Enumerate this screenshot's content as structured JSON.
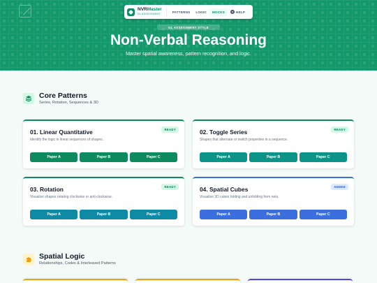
{
  "nav": {
    "brand_name_a": "NVR",
    "brand_name_b": "Master",
    "brand_tag": "GL ASSESSMENT",
    "items": [
      "PATTERNS",
      "LOGIC",
      "MOCKS",
      "HELP"
    ],
    "active": "MOCKS",
    "help_icon_glyph": "?"
  },
  "hero": {
    "pill": "GL ASSESSMENT STYLE",
    "title": "Non-Verbal Reasoning",
    "subtitle": "Master spatial awareness, pattern recognition, and logic."
  },
  "sections": [
    {
      "title": "Core Patterns",
      "desc": "Series, Rotation, Sequences & 3D",
      "icon": "layers-icon",
      "cards": [
        {
          "title": "01. Linear Quantitative",
          "desc": "Identify the logic in linear sequences of shapes.",
          "badge": "READY",
          "color": "#0e8a5f",
          "buttons": [
            "Paper A",
            "Paper B",
            "Paper C"
          ]
        },
        {
          "title": "02. Toggle Series",
          "desc": "Shapes that alternate or switch properties in a sequence.",
          "badge": "READY",
          "color": "#0d9488",
          "buttons": [
            "Paper A",
            "Paper B",
            "Paper C"
          ]
        },
        {
          "title": "03. Rotation",
          "desc": "Visualize shapes rotating clockwise or anti-clockwise.",
          "badge": "READY",
          "color": "#0e8aa5",
          "buttons": [
            "Paper A",
            "Paper B",
            "Paper C"
          ]
        },
        {
          "title": "04. Spatial Cubes",
          "desc": "Visualize 3D cubes folding and unfolding from nets.",
          "badge": "ADDED",
          "color": "#3b6fe0",
          "buttons": [
            "Paper A",
            "Paper B",
            "Paper C"
          ]
        }
      ]
    },
    {
      "title": "Spatial Logic",
      "desc": "Relationships, Codes & Interleaved Patterns",
      "icon": "puzzle-icon"
    }
  ],
  "colors": {
    "hero_bg": "#12996a",
    "partial_accents": [
      "#f59e0b",
      "#f59e0b",
      "#4f46e5"
    ]
  }
}
